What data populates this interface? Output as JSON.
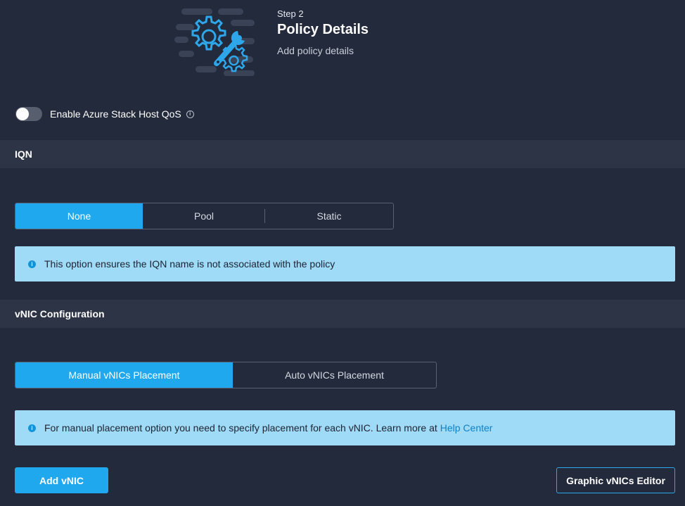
{
  "header": {
    "step_label": "Step 2",
    "title": "Policy Details",
    "subtitle": "Add policy details",
    "illustration": "gears-wrench-icon"
  },
  "qos_toggle": {
    "label": "Enable Azure Stack Host QoS",
    "enabled": false,
    "info_icon": "info-circle-icon"
  },
  "iqn_section": {
    "title": "IQN",
    "options": [
      {
        "label": "None",
        "selected": true
      },
      {
        "label": "Pool",
        "selected": false
      },
      {
        "label": "Static",
        "selected": false
      }
    ],
    "info_text": "This option ensures the IQN name is not associated with the policy"
  },
  "vnic_section": {
    "title": "vNIC Configuration",
    "options": [
      {
        "label": "Manual vNICs Placement",
        "selected": true
      },
      {
        "label": "Auto vNICs Placement",
        "selected": false
      }
    ],
    "info_text": "For manual placement option you need to specify placement for each vNIC. Learn more at",
    "info_link": "Help Center"
  },
  "actions": {
    "add_vnic": "Add vNIC",
    "graphic_editor": "Graphic vNICs Editor"
  },
  "colors": {
    "background": "#232a3b",
    "section_header": "#2d3446",
    "accent": "#1fa8ee",
    "info_banner": "#9fdaf6"
  }
}
